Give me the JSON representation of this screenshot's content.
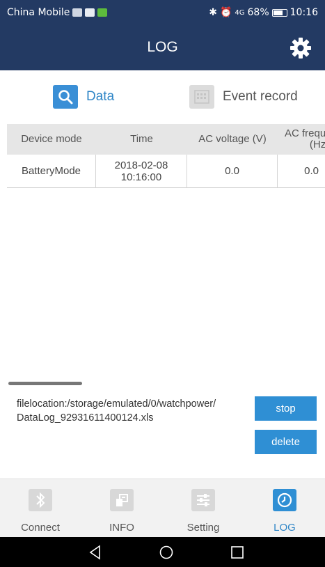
{
  "status_bar": {
    "carrier": "China Mobile",
    "signal_label": "4G",
    "battery": "68%",
    "time": "10:16"
  },
  "header": {
    "title": "LOG",
    "settings_icon": "gear-icon"
  },
  "tabs": [
    {
      "label": "Data",
      "icon": "search-icon",
      "active": true
    },
    {
      "label": "Event record",
      "icon": "keypad-icon",
      "active": false
    }
  ],
  "table": {
    "columns": [
      "Device mode",
      "Time",
      "AC voltage (V)",
      "AC frequency (Hz)"
    ],
    "column_visible": [
      "Device mode",
      "Time",
      "AC voltage (V)",
      "AC frequ\n(Hz"
    ],
    "rows": [
      [
        "BatteryMode",
        "2018-02-08 10:16:00",
        "0.0",
        "0.0"
      ]
    ]
  },
  "file": {
    "location": "filelocation:/storage/emulated/0/watchpower/\nDataLog_92931611400124.xls",
    "stop_label": "stop",
    "delete_label": "delete"
  },
  "bottom_nav": [
    {
      "label": "Connect",
      "icon": "bluetooth-icon",
      "active": false
    },
    {
      "label": "INFO",
      "icon": "info-icon",
      "active": false
    },
    {
      "label": "Setting",
      "icon": "settings-sliders-icon",
      "active": false
    },
    {
      "label": "LOG",
      "icon": "clock-icon",
      "active": true
    }
  ],
  "colors": {
    "header_bg": "#233a63",
    "accent": "#2f8fd4",
    "table_header_bg": "#e6e6e6"
  }
}
